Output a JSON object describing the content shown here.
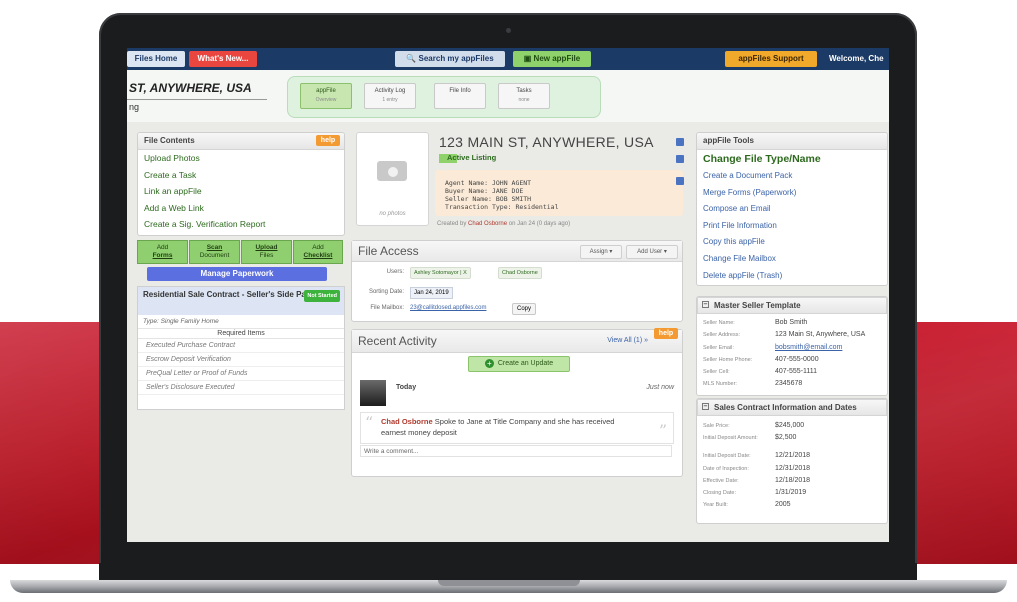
{
  "topbar": {
    "home": "Files Home",
    "whats_new": "What's New...",
    "search": "Search my appFiles",
    "new_appfile": "New appFile",
    "support": "appFiles Support",
    "welcome": "Welcome, Che"
  },
  "header": {
    "title": "ST, ANYWHERE, USA",
    "subtitle": "ng",
    "tabs": [
      {
        "label": "appFile",
        "sub": "Overview"
      },
      {
        "label": "Activity Log",
        "sub": "1 entry"
      },
      {
        "label": "File Info",
        "sub": ""
      },
      {
        "label": "Tasks",
        "sub": "none"
      }
    ]
  },
  "file_contents": {
    "title": "File Contents",
    "help": "help",
    "links": [
      "Upload Photos",
      "Create a Task",
      "Link an appFile",
      "Add a Web Link",
      "Create a Sig. Verification Report"
    ],
    "buttons": [
      {
        "top": "Add",
        "bottom": "Forms"
      },
      {
        "top": "Scan",
        "bottom": "Document"
      },
      {
        "top": "Upload",
        "bottom": "Files"
      },
      {
        "top": "Add",
        "bottom": "Checklist"
      }
    ],
    "manage": "Manage Paperwork"
  },
  "checklist": {
    "title": "Residential Sale Contract - Seller's Side Paperwor",
    "status": "Not Started",
    "type": "Type: Single Family Home",
    "required_header": "Required Items",
    "items": [
      "Executed Purchase Contract",
      "Escrow Deposit Verification",
      "PreQual Letter or Proof of Funds",
      "Seller's Disclosure Executed"
    ]
  },
  "listing": {
    "no_photos": "no photos",
    "address": "123 MAIN ST, ANYWHERE, USA",
    "status": "Active Listing",
    "agent": "Agent Name: JOHN AGENT",
    "buyer": "Buyer Name: JANE DOE",
    "seller": "Seller Name: BOB SMITH",
    "transaction": "Transaction Type: Residential",
    "created_prefix": "Created by",
    "created_by": "Chad Osborne",
    "created_suffix": "on Jan 24 (0 days ago)"
  },
  "file_access": {
    "title": "File Access",
    "assign": "Assign ▾",
    "add_user": "Add User ▾",
    "users_label": "Users:",
    "users": [
      "Ashley Sotomayor | X",
      "Chad Osborne"
    ],
    "sorting_label": "Sorting Date:",
    "sorting_date": "Jan 24, 2019",
    "mailbox_label": "File Mailbox:",
    "mailbox": "23@callitdosed.appfiles.com",
    "copy": "Copy"
  },
  "recent_activity": {
    "title": "Recent Activity",
    "view_all": "View All (1) »",
    "help": "help",
    "create_update": "Create an Update",
    "today": "Today",
    "time": "Just now",
    "author": "Chad Osborne",
    "message": "Spoke to Jane at Title Company and she has received earnest money deposit",
    "comment_placeholder": "Write a comment..."
  },
  "tools": {
    "title": "appFile Tools",
    "change_type": "Change File Type/Name",
    "links": [
      "Create a Document Pack",
      "Merge Forms (Paperwork)",
      "Compose an Email",
      "Print File Information",
      "Copy this appFile",
      "Change File Mailbox",
      "Delete appFile (Trash)"
    ]
  },
  "master_seller": {
    "title": "Master Seller Template",
    "rows": [
      {
        "k": "Seller Name:",
        "v": "Bob Smith"
      },
      {
        "k": "Seller Address:",
        "v": "123 Main St, Anywhere, USA"
      },
      {
        "k": "Seller Email:",
        "v": "bobsmith@email.com"
      },
      {
        "k": "Seller Home Phone:",
        "v": "407-555-0000"
      },
      {
        "k": "Seller Cell:",
        "v": "407-555-1111"
      },
      {
        "k": "MLS Number:",
        "v": "2345678"
      }
    ]
  },
  "sales_contract": {
    "title": "Sales Contract Information and Dates",
    "rows": [
      {
        "k": "Sale Price:",
        "v": "$245,000"
      },
      {
        "k": "Initial Deposit Amount:",
        "v": "$2,500"
      },
      {
        "k": "Initial Deposit Date:",
        "v": "12/21/2018"
      },
      {
        "k": "Date of Inspection:",
        "v": "12/31/2018"
      },
      {
        "k": "Effective Date:",
        "v": "12/18/2018"
      },
      {
        "k": "Closing Date:",
        "v": "1/31/2019"
      },
      {
        "k": "Year Built:",
        "v": "2005"
      }
    ]
  },
  "colors": {
    "brand_red": "#c7162a",
    "topbar_navy": "#1c3a66",
    "green_link": "#2d6a1e",
    "blue_link": "#3b63a8",
    "help_orange": "#f39a33"
  }
}
